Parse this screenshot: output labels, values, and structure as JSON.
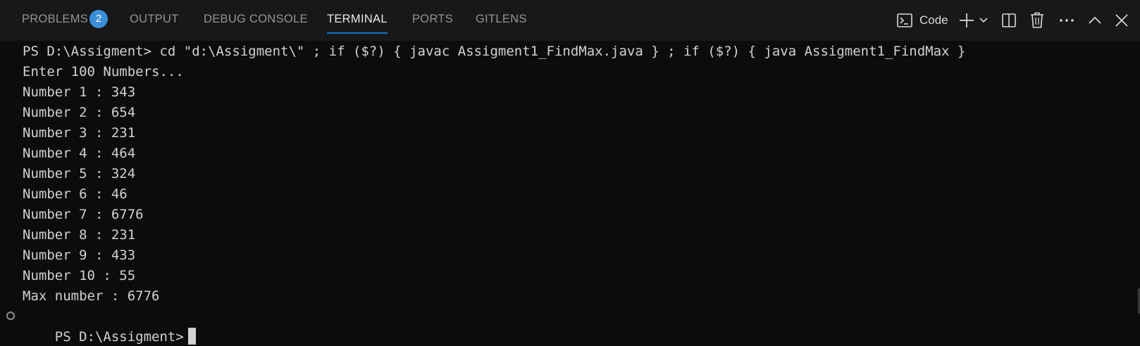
{
  "panel": {
    "tabs": [
      {
        "label": "PROBLEMS",
        "badge": "2"
      },
      {
        "label": "OUTPUT"
      },
      {
        "label": "DEBUG CONSOLE"
      },
      {
        "label": "TERMINAL",
        "active": true
      },
      {
        "label": "PORTS"
      },
      {
        "label": "GITLENS"
      }
    ],
    "actions": {
      "terminal_profile_label": "Code",
      "icons": [
        "terminal-icon",
        "plus-icon",
        "chevron-down-icon",
        "split-icon",
        "trash-icon",
        "more-icon",
        "chevron-up-icon",
        "close-icon"
      ]
    }
  },
  "terminal": {
    "lines": [
      "PS D:\\Assigment> cd \"d:\\Assigment\\\" ; if ($?) { javac Assigment1_FindMax.java } ; if ($?) { java Assigment1_FindMax }",
      "Enter 100 Numbers...",
      "Number 1 : 343",
      "Number 2 : 654",
      "Number 3 : 231",
      "Number 4 : 464",
      "Number 5 : 324",
      "Number 6 : 46",
      "Number 7 : 6776",
      "Number 8 : 231",
      "Number 9 : 433",
      "Number 10 : 55",
      "Max number : 6776"
    ],
    "prompt": "PS D:\\Assigment>"
  },
  "colors": {
    "panel_bg": "#181818",
    "terminal_bg": "#0c0c0c",
    "accent": "#0e74d3",
    "badge": "#3a8fd6"
  }
}
